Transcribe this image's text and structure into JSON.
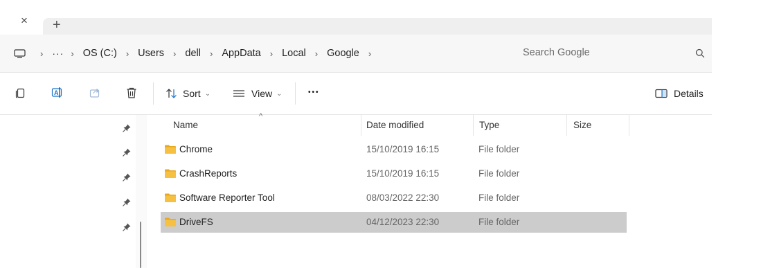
{
  "tab": {
    "close_glyph": "×",
    "new_tab_glyph": "+"
  },
  "address": {
    "ellipsis": "···",
    "crumbs": [
      "OS (C:)",
      "Users",
      "dell",
      "AppData",
      "Local",
      "Google"
    ],
    "separator": "›",
    "search_placeholder": "Search Google"
  },
  "toolbar": {
    "sort_label": "Sort",
    "view_label": "View",
    "more_label": "•••",
    "details_label": "Details"
  },
  "columns": {
    "name": "Name",
    "date": "Date modified",
    "type": "Type",
    "size": "Size"
  },
  "files": [
    {
      "name": "Chrome",
      "date": "15/10/2019 16:15",
      "type": "File folder"
    },
    {
      "name": "CrashReports",
      "date": "15/10/2019 16:15",
      "type": "File folder"
    },
    {
      "name": "Software Reporter Tool",
      "date": "08/03/2022 22:30",
      "type": "File folder"
    },
    {
      "name": "DriveFS",
      "date": "04/12/2023 22:30",
      "type": "File folder"
    }
  ],
  "colors": {
    "selected_row": "#cccccc",
    "folder": "#f6c142",
    "details_accent": "#1a73c8"
  }
}
